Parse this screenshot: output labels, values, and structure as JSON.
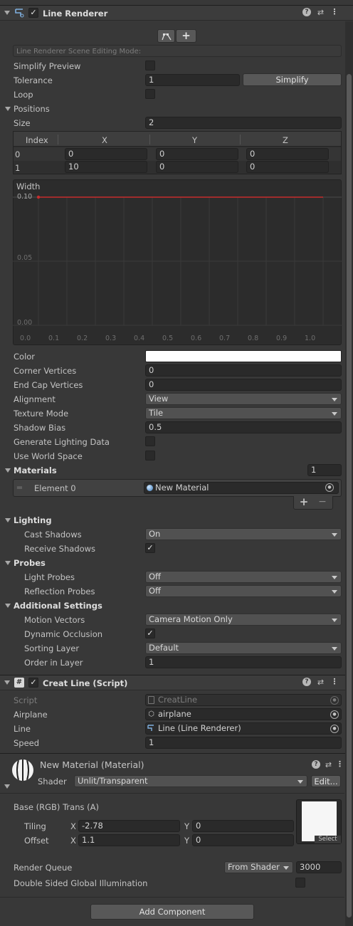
{
  "line_renderer": {
    "title": "Line Renderer",
    "enabled": true,
    "edit_mode_label": "Line Renderer Scene Editing Mode:",
    "simplify_preview_label": "Simplify Preview",
    "simplify_preview": false,
    "tolerance_label": "Tolerance",
    "tolerance": "1",
    "simplify_button": "Simplify",
    "loop_label": "Loop",
    "loop": false,
    "positions_label": "Positions",
    "size_label": "Size",
    "size": "2",
    "table_headers": [
      "Index",
      "X",
      "Y",
      "Z"
    ],
    "rows": [
      {
        "index": "0",
        "x": "0",
        "y": "0",
        "z": "0"
      },
      {
        "index": "1",
        "x": "10",
        "y": "0",
        "z": "0"
      }
    ],
    "width_label": "Width",
    "curve_y_ticks": [
      "0.10",
      "0.05",
      "0.00"
    ],
    "curve_x_ticks": [
      "0.0",
      "0.1",
      "0.2",
      "0.3",
      "0.4",
      "0.5",
      "0.6",
      "0.7",
      "0.8",
      "0.9",
      "1.0"
    ],
    "color_label": "Color",
    "color_value": "#ffffff",
    "corner_vertices_label": "Corner Vertices",
    "corner_vertices": "0",
    "end_cap_vertices_label": "End Cap Vertices",
    "end_cap_vertices": "0",
    "alignment_label": "Alignment",
    "alignment": "View",
    "texture_mode_label": "Texture Mode",
    "texture_mode": "Tile",
    "shadow_bias_label": "Shadow Bias",
    "shadow_bias": "0.5",
    "generate_lighting_label": "Generate Lighting Data",
    "generate_lighting": false,
    "use_world_space_label": "Use World Space",
    "use_world_space": false,
    "materials_label": "Materials",
    "materials_count": "1",
    "element0_label": "Element 0",
    "element0_value": "New Material",
    "lighting_label": "Lighting",
    "cast_shadows_label": "Cast Shadows",
    "cast_shadows": "On",
    "receive_shadows_label": "Receive Shadows",
    "receive_shadows": true,
    "probes_label": "Probes",
    "light_probes_label": "Light Probes",
    "light_probes": "Off",
    "reflection_probes_label": "Reflection Probes",
    "reflection_probes": "Off",
    "additional_label": "Additional Settings",
    "motion_vectors_label": "Motion Vectors",
    "motion_vectors": "Camera Motion Only",
    "dynamic_occlusion_label": "Dynamic Occlusion",
    "dynamic_occlusion": true,
    "sorting_layer_label": "Sorting Layer",
    "sorting_layer": "Default",
    "order_in_layer_label": "Order in Layer",
    "order_in_layer": "1"
  },
  "creat_line": {
    "title": "Creat Line (Script)",
    "enabled": true,
    "script_label": "Script",
    "script_value": "CreatLine",
    "airplane_label": "Airplane",
    "airplane_value": "airplane",
    "line_label": "Line",
    "line_value": "Line (Line Renderer)",
    "speed_label": "Speed",
    "speed_value": "1"
  },
  "material": {
    "title": "New Material (Material)",
    "shader_label": "Shader",
    "shader_value": "Unlit/Transparent",
    "edit_button": "Edit...",
    "base_label": "Base (RGB) Trans (A)",
    "tiling_label": "Tiling",
    "tiling_x": "-2.78",
    "tiling_y": "0",
    "offset_label": "Offset",
    "offset_x": "1.1",
    "offset_y": "0",
    "x_label": "X",
    "y_label": "Y",
    "select_label": "Select",
    "render_queue_label": "Render Queue",
    "render_queue_mode": "From Shader",
    "render_queue_value": "3000",
    "double_sided_label": "Double Sided Global Illumination",
    "double_sided": false
  },
  "add_component_button": "Add Component",
  "colors": {
    "curve": "#c62d2d",
    "panel": "#383838",
    "field": "#2a2a2a"
  }
}
